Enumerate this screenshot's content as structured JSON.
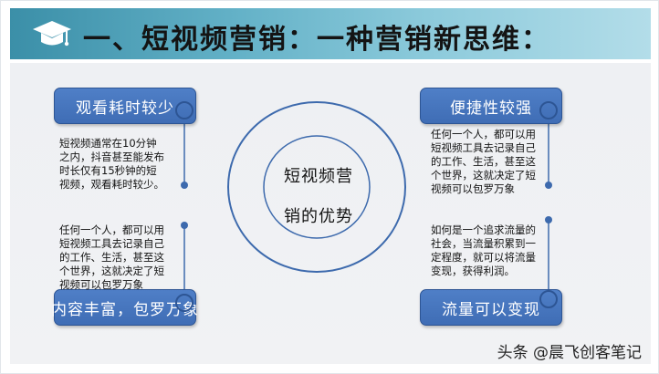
{
  "header": {
    "title": "一、短视频营销：一种营销新思维："
  },
  "center": {
    "line1": "短视频营",
    "line2": "销的优势"
  },
  "cards": {
    "tl": {
      "title": "观看耗时较少",
      "text": "短视频通常在10分钟\n之内，抖音甚至能发布\n时长仅有15秒钟的短\n视频，观看耗时较少。"
    },
    "bl": {
      "title": "内容丰富，包罗万象",
      "text": "任何一个人，都可以用\n短视频工具去记录自己\n的工作、生活，甚至这\n个世界，这就决定了短\n视频可以包罗万象"
    },
    "tr": {
      "title": "便捷性较强",
      "text": "任何一个人，都可以用\n短视频工具去记录自己\n的工作、生活，甚至这\n个世界，这就决定了短\n视频可以包罗万象"
    },
    "br": {
      "title": "流量可以变现",
      "text": "如何是一个追求流量的\n社会，当流量积累到一\n定程度，就可以将流量\n变现，获得利润。"
    }
  },
  "watermark": {
    "text": "头条 @晨飞创客笔记"
  },
  "colors": {
    "pill": "#4a78c0",
    "line": "#3d6aad",
    "header_start": "#3b8fa8"
  }
}
